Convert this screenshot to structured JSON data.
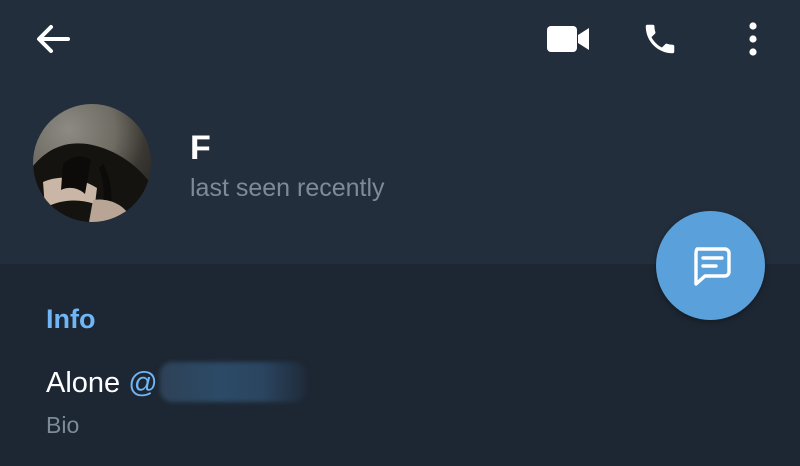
{
  "toolbar": {
    "back_icon": "arrow-left-icon",
    "video_icon": "video-camera-icon",
    "call_icon": "phone-icon",
    "more_icon": "more-vertical-icon"
  },
  "profile": {
    "name": "F",
    "status": "last seen recently"
  },
  "fab": {
    "icon": "message-icon"
  },
  "info": {
    "section_title": "Info",
    "bio_text": "Alone",
    "username_prefix": "@",
    "bio_label": "Bio"
  },
  "colors": {
    "header_bg": "#232e3c",
    "page_bg": "#1d2733",
    "accent": "#70b5f5",
    "fab": "#5aa1dc",
    "secondary_text": "#7d8b99"
  }
}
